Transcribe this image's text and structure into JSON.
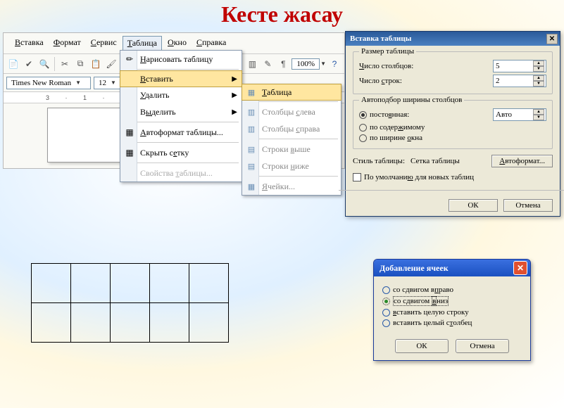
{
  "page_title": "Кесте жасау",
  "menubar": [
    "Вставка",
    "Формат",
    "Сервис",
    "Таблица",
    "Окно",
    "Справка"
  ],
  "active_menu_index": 3,
  "toolbar": {
    "zoom": "100%"
  },
  "fontrow": {
    "font": "Times New Roman",
    "size": "12"
  },
  "ruler_text": "3 · 1 · 2 · 1 · 1 · 1 ·",
  "menu1": {
    "items": [
      {
        "label": "Нарисовать таблицу",
        "icon": "✏",
        "u": 0
      },
      {
        "sep": true
      },
      {
        "label": "Вставить",
        "arrow": true,
        "hl": true,
        "u": 0
      },
      {
        "label": "Удалить",
        "arrow": true,
        "u": 0
      },
      {
        "label": "Выделить",
        "arrow": true,
        "u": 1
      },
      {
        "sep": true
      },
      {
        "label": "Автоформат таблицы...",
        "icon": "▦",
        "u": 0
      },
      {
        "sep": true
      },
      {
        "label": "Скрыть сетку",
        "icon": "▦",
        "u": 8
      },
      {
        "sep": true
      },
      {
        "label": "Свойства таблицы...",
        "dis": true,
        "u": 9
      }
    ]
  },
  "menu2": {
    "items": [
      {
        "label": "Таблица",
        "icon": "▦",
        "hl": true,
        "u": 0
      },
      {
        "sep": true
      },
      {
        "label": "Столбцы слева",
        "icon": "▥",
        "u": 8
      },
      {
        "label": "Столбцы справа",
        "icon": "▥",
        "u": 8
      },
      {
        "sep": true
      },
      {
        "label": "Строки выше",
        "icon": "▤",
        "u": 7
      },
      {
        "label": "Строки ниже",
        "icon": "▤",
        "u": 7
      },
      {
        "sep": true
      },
      {
        "label": "Ячейки...",
        "icon": "▦",
        "u": 0
      }
    ]
  },
  "dlg1": {
    "title": "Вставка таблицы",
    "grp_size": "Размер таблицы",
    "cols_label": "Число столбцов:",
    "cols_value": "5",
    "rows_label": "Число строк:",
    "rows_value": "2",
    "grp_auto": "Автоподбор ширины столбцов",
    "r1": "постоянная:",
    "r2": "по содержимому",
    "r3": "по ширине окна",
    "auto_value": "Авто",
    "style_label": "Стиль таблицы:",
    "style_value": "Сетка таблицы",
    "autoformat_btn": "Автоформат...",
    "default_chk": "По умолчанию для новых таблиц",
    "ok": "ОК",
    "cancel": "Отмена"
  },
  "dlg2": {
    "title": "Добавление ячеек",
    "opts": [
      {
        "label": "со сдвигом вправо",
        "u": 12
      },
      {
        "label": "со сдвигом вниз",
        "sel": true,
        "u": 11
      },
      {
        "label": "вставить целую строку",
        "u": 0
      },
      {
        "label": "вставить целый столбец",
        "u": 16
      }
    ],
    "ok": "ОК",
    "cancel": "Отмена"
  },
  "sample_table": {
    "rows": 2,
    "cols": 5
  }
}
